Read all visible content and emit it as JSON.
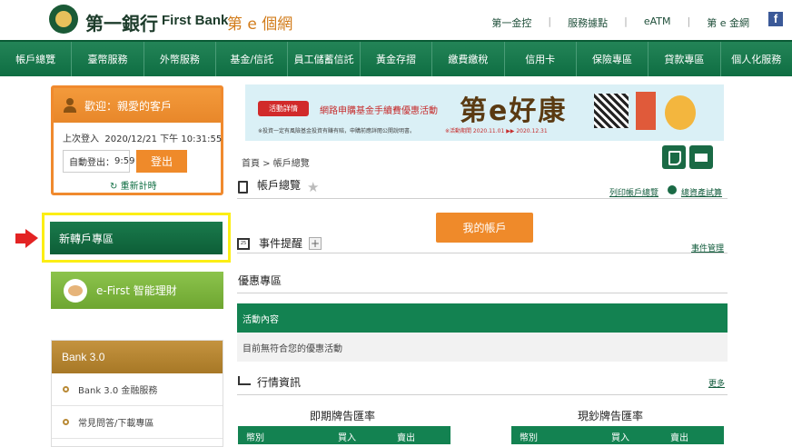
{
  "header": {
    "brand_cn": "第一銀行",
    "brand_en": "First Bank",
    "brand_sub": "第 e 個網",
    "links": [
      "第一金控",
      "服務據點",
      "eATM",
      "第 e 金網"
    ],
    "separator": "|",
    "fb": "f"
  },
  "nav": [
    "帳戶總覽",
    "臺幣服務",
    "外幣服務",
    "基金/信託",
    "員工儲蓄信託",
    "黃金存摺",
    "繳費繳稅",
    "信用卡",
    "保險專區",
    "貸款專區",
    "個人化服務"
  ],
  "welcome": {
    "title": "歡迎：親愛的客戶",
    "last_login_label": "上次登入",
    "last_login": "2020/12/21 下午 10:31:55",
    "auto_logout_label": "自動登出",
    "countdown": "9:59",
    "colon": "：",
    "logout": "登出",
    "refresh": "重新計時",
    "refresh_icon": "↻"
  },
  "side": {
    "new_account": "新轉戶專區",
    "efirst": "e-First 智能理財",
    "bank3_title": "Bank 3.0",
    "bank3_items": [
      "Bank 3.0 金融服務",
      "常見問答/下載專區"
    ]
  },
  "banner": {
    "button": "活動詳情",
    "title": "網路申購基金手續費優惠活動",
    "big": "第e好康",
    "fine": "※投資一定有風險基金投資有賺有賠，申購前應詳閱公開說明書。",
    "date": "※活動期間 2020.11.01 ▶▶ 2020.12.31"
  },
  "main": {
    "breadcrumb": "首頁 > 帳戶總覽",
    "title": "帳戶總覽",
    "print_link": "列印帳戶總覽",
    "asset_link": "總資產試算",
    "my_account": "我的帳戶",
    "event_title": "事件提醒",
    "event_link": "事件管理",
    "promo_title": "優惠專區",
    "activity_bar": "活動內容",
    "no_activity": "目前無符合您的優惠活動",
    "market_title": "行情資訊",
    "more": "更多",
    "spot_rate": "即期牌告匯率",
    "cash_rate": "現鈔牌告匯率",
    "rate_cols": [
      "幣別",
      "買入",
      "賣出"
    ],
    "plus": "+",
    "star": "★",
    "cal_day": "25"
  }
}
